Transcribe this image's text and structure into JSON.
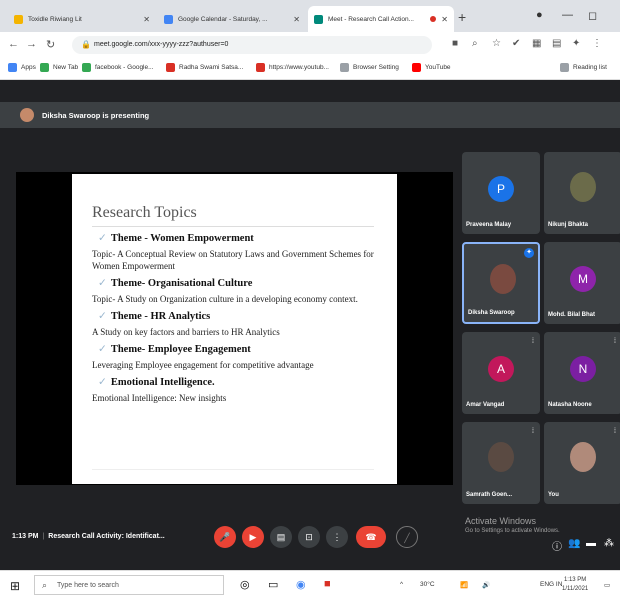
{
  "browser": {
    "tabs": [
      {
        "title": "Toxidle Riwiang Lit",
        "active": false
      },
      {
        "title": "Google Calendar - Saturday, ...",
        "active": false
      },
      {
        "title": "Meet - Research Call Action...",
        "active": true
      }
    ],
    "url": "meet.google.com/xxx-yyyy-zzz?authuser=0",
    "bookmarks": [
      "Apps",
      "New Tab",
      "facebook - Google...",
      "Radha Swami Satsa...",
      "https://www.youtub...",
      "Browser Setting",
      "YouTube",
      "Reading list"
    ]
  },
  "meet": {
    "presenting_text": "Diksha Swaroop is presenting",
    "slide": {
      "title": "Research Topics",
      "items": [
        {
          "theme": "Theme - Women Empowerment",
          "topic": "Topic- A Conceptual Review on Statutory Laws and Government Schemes for Women Empowerment"
        },
        {
          "theme": "Theme- Organisational Culture",
          "topic": "Topic- A Study on Organization culture in a developing economy context."
        },
        {
          "theme": "Theme - HR Analytics",
          "topic": "A Study on key factors and barriers to HR Analytics"
        },
        {
          "theme": "Theme- Employee Engagement",
          "topic": "Leveraging Employee engagement for competitive advantage"
        },
        {
          "theme": "Emotional Intelligence.",
          "topic": "Emotional Intelligence: New insights"
        }
      ]
    },
    "participants": [
      {
        "name": "Praveena Malay",
        "initial": "P",
        "color": "#1a73e8",
        "photo": false
      },
      {
        "name": "Nikunj Bhakta",
        "initial": "",
        "color": "#6b6b4a",
        "photo": true
      },
      {
        "name": "Diksha Swaroop",
        "initial": "",
        "color": "#7a4a40",
        "photo": true,
        "pinned": true
      },
      {
        "name": "Mohd. Bilal Bhat",
        "initial": "M",
        "color": "#8e24aa",
        "photo": false
      },
      {
        "name": "Amar Vangad",
        "initial": "A",
        "color": "#c2185b",
        "photo": false
      },
      {
        "name": "Natasha Noone",
        "initial": "N",
        "color": "#7b1fa2",
        "photo": false
      },
      {
        "name": "Samrath Goen...",
        "initial": "",
        "color": "#5a4a42",
        "photo": true
      },
      {
        "name": "You",
        "initial": "",
        "color": "#b08a7a",
        "photo": true
      }
    ],
    "time": "1:13 PM",
    "meeting_name": "Research Call Activity: Identificat...",
    "activate_title": "Activate Windows",
    "activate_sub": "Go to Settings to activate Windows."
  },
  "taskbar": {
    "search_placeholder": "Type here to search",
    "weather": "30°C",
    "language": "ENG IN",
    "clock_time": "1:13 PM",
    "clock_date": "1/11/2021"
  }
}
